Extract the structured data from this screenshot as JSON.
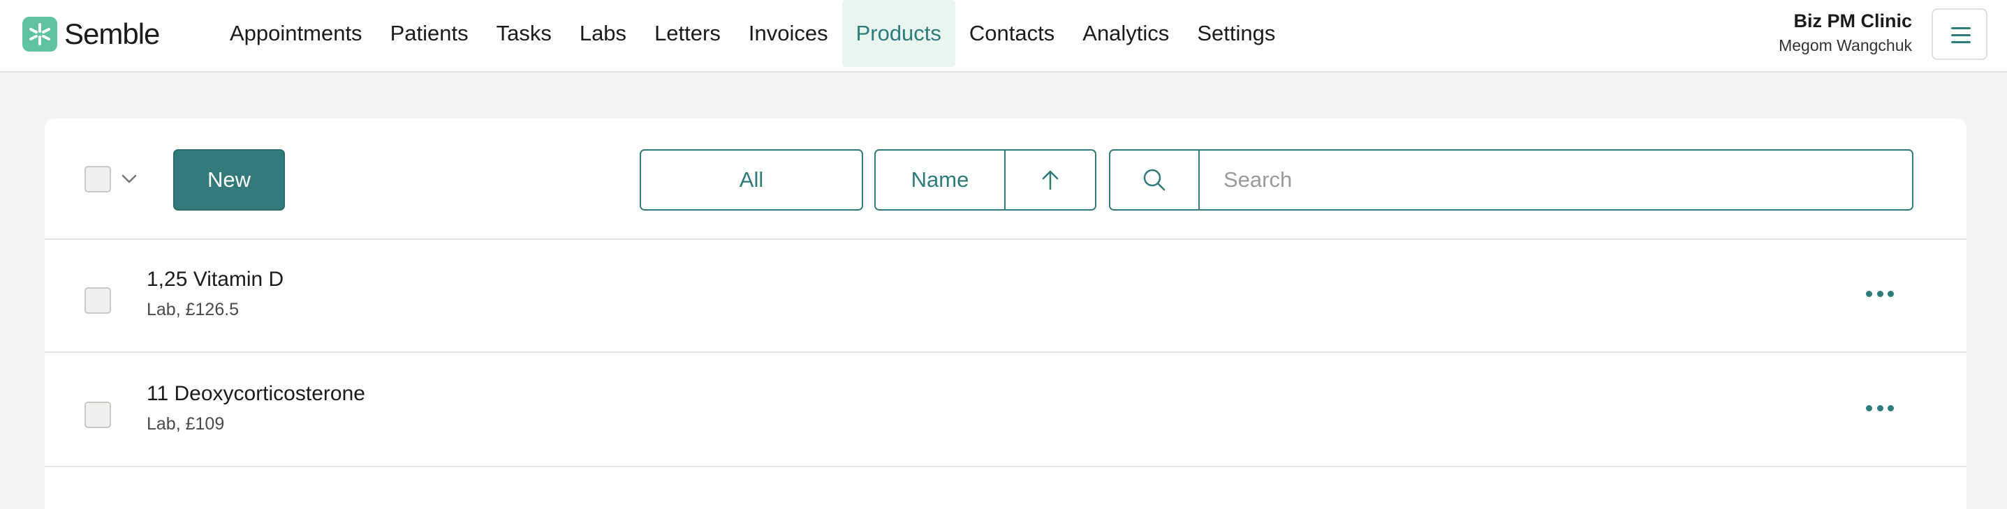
{
  "brand": {
    "name": "Semble",
    "accent": "#5fc2a3",
    "primary": "#337b7b"
  },
  "nav": {
    "items": [
      {
        "label": "Appointments"
      },
      {
        "label": "Patients"
      },
      {
        "label": "Tasks"
      },
      {
        "label": "Labs"
      },
      {
        "label": "Letters"
      },
      {
        "label": "Invoices"
      },
      {
        "label": "Products",
        "active": true
      },
      {
        "label": "Contacts"
      },
      {
        "label": "Analytics"
      },
      {
        "label": "Settings"
      }
    ]
  },
  "account": {
    "clinic": "Biz PM Clinic",
    "user": "Megom Wangchuk",
    "menu_icon": "hamburger-icon"
  },
  "toolbar": {
    "new_label": "New",
    "filter_label": "All",
    "sort_label": "Name",
    "sort_icon": "arrow-up-icon",
    "search_icon": "search-icon",
    "search_placeholder": "Search"
  },
  "products": [
    {
      "name": "1,25 Vitamin D",
      "detail": "Lab, £126.5"
    },
    {
      "name": "11 Deoxycorticosterone",
      "detail": "Lab, £109"
    }
  ]
}
